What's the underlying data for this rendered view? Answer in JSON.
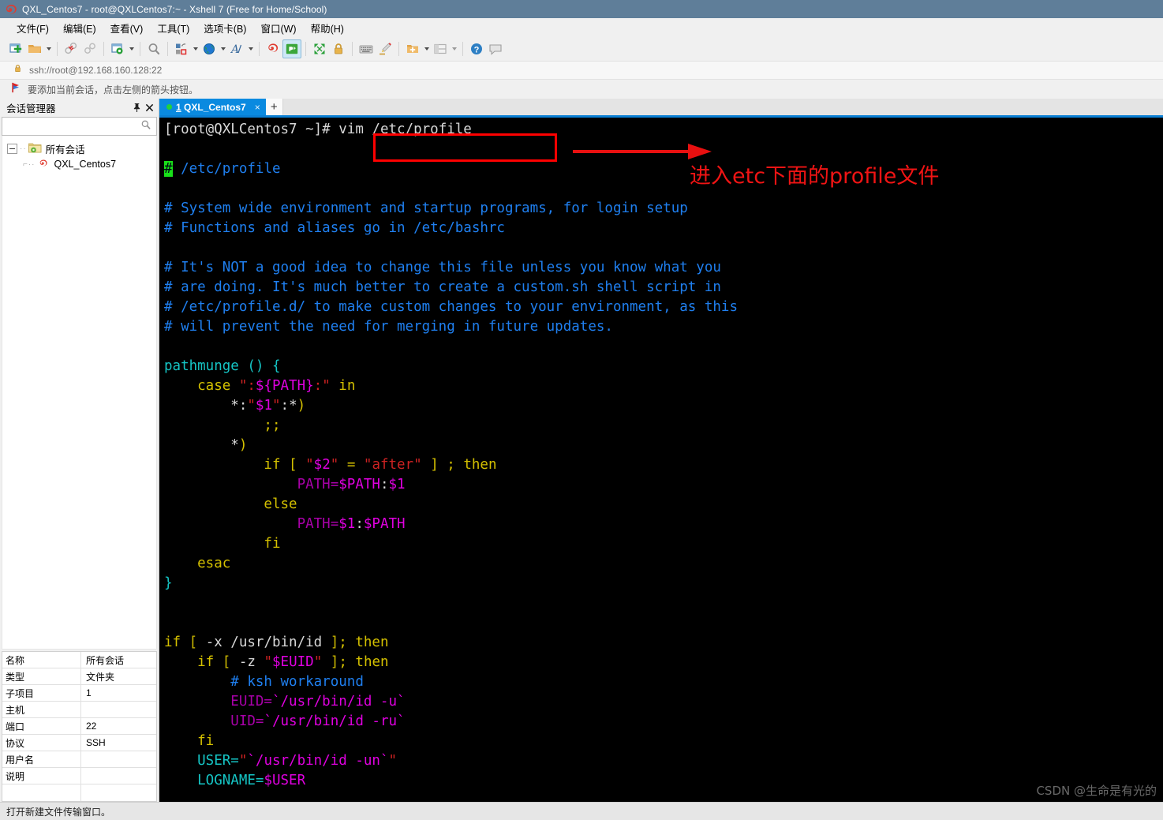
{
  "window": {
    "title": "QXL_Centos7 - root@QXLCentos7:~ - Xshell 7 (Free for Home/School)",
    "logo_icon": "xshell-spiral-logo-icon"
  },
  "menubar": {
    "items": [
      {
        "label": "文件(F)",
        "name": "menu-file"
      },
      {
        "label": "编辑(E)",
        "name": "menu-edit"
      },
      {
        "label": "查看(V)",
        "name": "menu-view"
      },
      {
        "label": "工具(T)",
        "name": "menu-tools"
      },
      {
        "label": "选项卡(B)",
        "name": "menu-tab"
      },
      {
        "label": "窗口(W)",
        "name": "menu-window"
      },
      {
        "label": "帮助(H)",
        "name": "menu-help"
      }
    ]
  },
  "toolbar": {
    "icons": [
      "new-session-icon",
      "open-folder-icon",
      "disconnect-icon",
      "reconnect-icon",
      "session-properties-icon",
      "find-icon",
      "layout-icon",
      "globe-icon",
      "font-icon",
      "xshell-icon",
      "xftp-icon",
      "fullscreen-icon",
      "lock-icon",
      "keyboard-icon",
      "highlight-pen-icon",
      "new-folder-icon",
      "split-view-icon",
      "help-icon",
      "comment-icon"
    ]
  },
  "addressbar": {
    "lock_icon": "lock-icon",
    "value": "ssh://root@192.168.160.128:22"
  },
  "hintbar": {
    "flag_icon": "red-flag-icon",
    "text": "要添加当前会话，点击左侧的箭头按钮。"
  },
  "sidebar": {
    "title": "会话管理器",
    "pin_icon": "pin-icon",
    "close_icon": "close-icon",
    "search": {
      "value": "",
      "placeholder": "",
      "icon": "search-icon"
    },
    "tree": {
      "root": {
        "label": "所有会话",
        "icon": "folder-sessions-icon"
      },
      "children": [
        {
          "label": "QXL_Centos7",
          "icon": "xshell-session-icon"
        }
      ]
    },
    "properties": [
      {
        "key": "名称",
        "value": "所有会话"
      },
      {
        "key": "类型",
        "value": "文件夹"
      },
      {
        "key": "子项目",
        "value": "1"
      },
      {
        "key": "主机",
        "value": ""
      },
      {
        "key": "端口",
        "value": "22"
      },
      {
        "key": "协议",
        "value": "SSH"
      },
      {
        "key": "用户名",
        "value": ""
      },
      {
        "key": "说明",
        "value": ""
      },
      {
        "key": "",
        "value": ""
      }
    ]
  },
  "tabbar": {
    "tabs": [
      {
        "index": "1",
        "label": "QXL_Centos7",
        "status_icon": "connected-dot-icon",
        "close_icon": "close-icon"
      }
    ],
    "add_label": "+"
  },
  "terminal": {
    "prompt": "[root@QXLCentos7 ~]#",
    "command": "vim /etc/profile",
    "cursor_char": "#",
    "lines": [
      {
        "id": "filename",
        "text": "/etc/profile"
      },
      {
        "id": "c1",
        "text": "# System wide environment and startup programs, for login setup"
      },
      {
        "id": "c2",
        "text": "# Functions and aliases go in /etc/bashrc"
      },
      {
        "id": "c3",
        "text": "# It's NOT a good idea to change this file unless you know what you"
      },
      {
        "id": "c4",
        "text": "# are doing. It's much better to create a custom.sh shell script in"
      },
      {
        "id": "c5",
        "text": "# /etc/profile.d/ to make custom changes to your environment, as this"
      },
      {
        "id": "c6",
        "text": "# will prevent the need for merging in future updates."
      },
      {
        "id": "f1",
        "text": "pathmunge () {"
      },
      {
        "id": "f2",
        "text": "    case \":${PATH}:\" in"
      },
      {
        "id": "f3",
        "text": "        *:\"$1\":*)"
      },
      {
        "id": "f4",
        "text": "            ;;"
      },
      {
        "id": "f5",
        "text": "        *)"
      },
      {
        "id": "f6",
        "text": "            if [ \"$2\" = \"after\" ] ; then"
      },
      {
        "id": "f7",
        "text": "                PATH=$PATH:$1"
      },
      {
        "id": "f8",
        "text": "            else"
      },
      {
        "id": "f9",
        "text": "                PATH=$1:$PATH"
      },
      {
        "id": "f10",
        "text": "            fi"
      },
      {
        "id": "f11",
        "text": "    esac"
      },
      {
        "id": "f12",
        "text": "}"
      },
      {
        "id": "g1",
        "text": "if [ -x /usr/bin/id ]; then"
      },
      {
        "id": "g2",
        "text": "    if [ -z \"$EUID\" ]; then"
      },
      {
        "id": "g3",
        "text": "        # ksh workaround"
      },
      {
        "id": "g4",
        "text": "        EUID=`/usr/bin/id -u`"
      },
      {
        "id": "g5",
        "text": "        UID=`/usr/bin/id -ru`"
      },
      {
        "id": "g6",
        "text": "    fi"
      },
      {
        "id": "g7",
        "text": "    USER=\"`/usr/bin/id -un`\""
      },
      {
        "id": "g8",
        "text": "    LOGNAME=$USER"
      }
    ]
  },
  "annotation": {
    "text": "进入etc下面的profile文件",
    "color": "#f01414",
    "box_color": "#ff0000",
    "arrow_icon": "arrow-right-icon"
  },
  "watermark": {
    "text": "CSDN @生命是有光的"
  },
  "statusbar": {
    "text": "打开新建文件传输窗口。"
  },
  "colors": {
    "titlebar": "#5f7e99",
    "tab_active": "#0a8ae0",
    "tab_underline": "#0a7fd4",
    "terminal_bg": "#000000",
    "comment": "#1f7fef",
    "keyword": "#d4c000",
    "string": "#cc2222",
    "variable": "#e000e0",
    "function": "#15c5c5",
    "cursor": "#19e019"
  }
}
